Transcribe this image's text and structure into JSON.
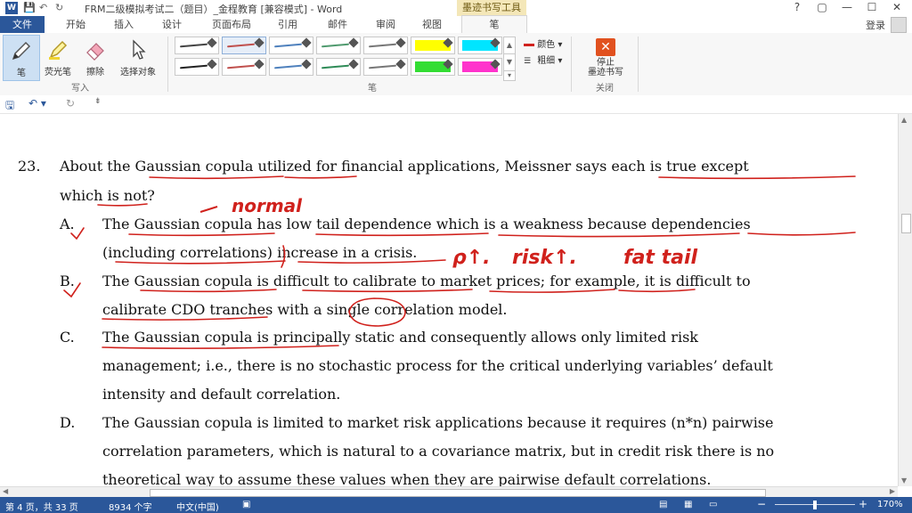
{
  "window": {
    "title": "FRM二级模拟考试二（题目）_金程教育 [兼容模式] - Word",
    "contextual_tab": "墨迹书写工具",
    "help": "?",
    "restore": "▢",
    "minimize": "—",
    "maximize": "☐",
    "close": "✕"
  },
  "tabs": [
    "文件",
    "开始",
    "插入",
    "设计",
    "页面布局",
    "引用",
    "邮件",
    "审阅",
    "视图",
    "笔"
  ],
  "account": {
    "login": "登录"
  },
  "ribbon": {
    "write_group": {
      "label": "写入",
      "pen": "笔",
      "highlighter": "荧光笔",
      "eraser": "擦除",
      "select": "选择对象"
    },
    "pens_group": {
      "label": "笔",
      "color": "颜色",
      "thickness": "粗细"
    },
    "close_group": {
      "label": "关闭",
      "stop": "停止\n墨迹书写"
    },
    "pen_colors": [
      "#444444",
      "#c0504d",
      "#4f81bd",
      "#4f9a6e",
      "#777777",
      "#ffff00",
      "#00e5ff",
      "#222222",
      "#c0504d",
      "#4f81bd",
      "#2e8b57",
      "#777777",
      "#33dd33",
      "#ff33cc"
    ]
  },
  "document": {
    "q_number": "23.",
    "q_line1": "About the Gaussian copula utilized for financial applications, Meissner says each is true except",
    "q_line2": "which is not?",
    "options": [
      {
        "letter": "A.",
        "lines": [
          "The Gaussian copula has low tail dependence which is a weakness because dependencies",
          "(including correlations) increase in a crisis."
        ]
      },
      {
        "letter": "B.",
        "lines": [
          "The Gaussian copula is difficult to calibrate to market prices; for example, it is difficult to",
          "calibrate CDO tranches with a single correlation model."
        ]
      },
      {
        "letter": "C.",
        "lines": [
          "The Gaussian copula is principally static and consequently allows only limited risk",
          "management; i.e., there is no stochastic process for the critical underlying variables’ default",
          "intensity and default correlation."
        ]
      },
      {
        "letter": "D.",
        "lines": [
          "The Gaussian copula is limited to market risk applications because it requires (n*n) pairwise",
          "correlation parameters, which is natural to a covariance matrix, but in credit risk there is no",
          "theoretical way to assume these values when they are pairwise default correlations."
        ]
      }
    ],
    "handwriting": {
      "normal": "normal",
      "rho_up": "ρ↑.",
      "risk_up": "risk↑.",
      "fat_tail": "fat tail"
    },
    "ink_color": "#d0211c"
  },
  "status": {
    "page": "第 4 页，共 33 页",
    "words": "8934 个字",
    "lang": "中文(中国)",
    "zoom": "170%",
    "zoom_minus": "−",
    "zoom_plus": "+"
  }
}
